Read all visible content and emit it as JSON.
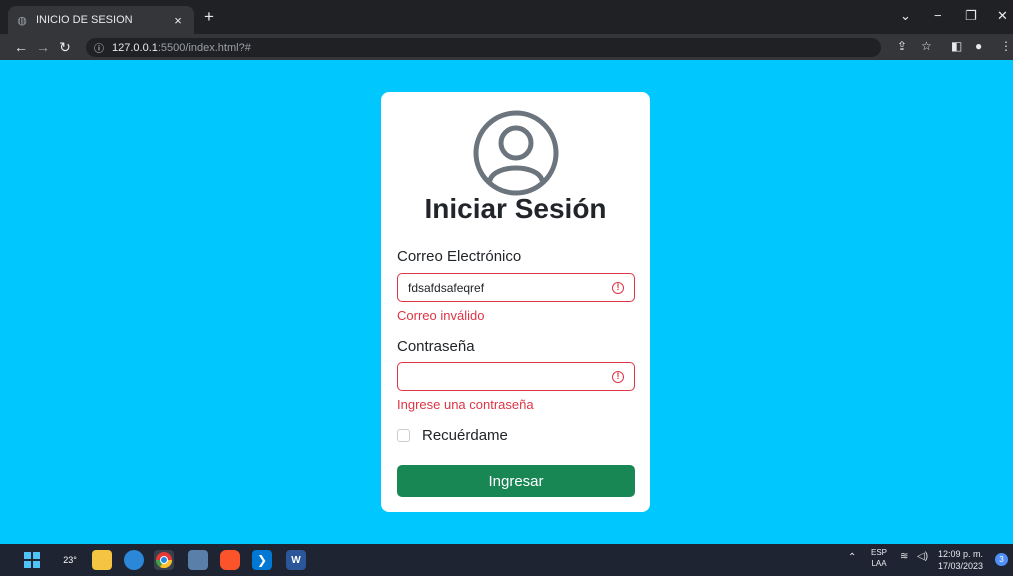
{
  "browser": {
    "tab_title": "INICIO DE SESION",
    "tab_close": "×",
    "new_tab": "+",
    "url_host": "127.0.0.1",
    "url_rest": ":5500/index.html?#",
    "window_min": "−",
    "window_restore": "❐",
    "window_close": "✕",
    "window_menu": "⌄"
  },
  "login": {
    "heading": "Iniciar Sesión",
    "email_label": "Correo Electrónico",
    "email_value": "fdsafdsafeqref",
    "email_error": "Correo inválido",
    "password_label": "Contraseña",
    "password_value": "",
    "password_error": "Ingrese una contraseña",
    "remember_label": "Recuérdame",
    "submit_label": "Ingresar"
  },
  "taskbar": {
    "weather_temp": "23°",
    "lang_top": "ESP",
    "lang_bottom": "LAA",
    "time": "12:09 p. m.",
    "date": "17/03/2023",
    "notification_count": "3"
  },
  "colors": {
    "background": "#00c8ff",
    "error": "#dc3545",
    "submit": "#198754"
  }
}
